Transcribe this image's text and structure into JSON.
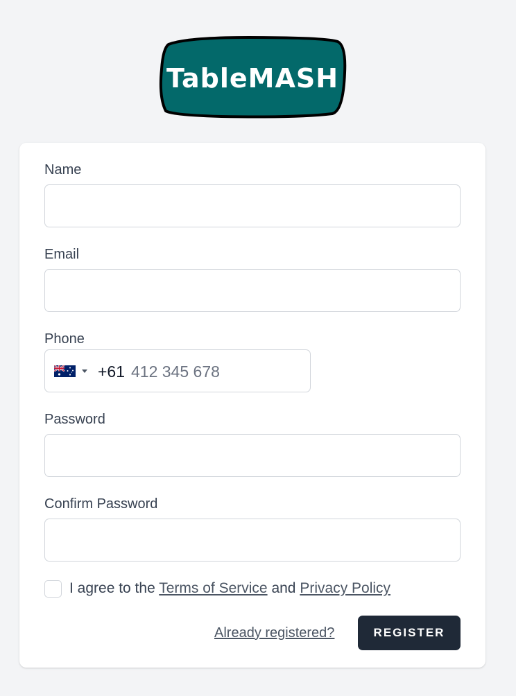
{
  "brand": {
    "logo_text": "TableMASH",
    "logo_fill": "#03696a",
    "logo_stroke": "#000000"
  },
  "form": {
    "name": {
      "label": "Name",
      "value": ""
    },
    "email": {
      "label": "Email",
      "value": ""
    },
    "phone": {
      "label": "Phone",
      "country_flag": "australia-flag",
      "dial_code": "+61",
      "value": "",
      "placeholder": "412 345 678"
    },
    "password": {
      "label": "Password",
      "value": ""
    },
    "confirm_password": {
      "label": "Confirm Password",
      "value": ""
    },
    "agree": {
      "checked": false,
      "prefix": "I agree to the",
      "terms_link": "Terms of Service",
      "conjunction": "and",
      "privacy_link": "Privacy Policy"
    },
    "already_registered_link": "Already registered?",
    "register_button": "REGISTER"
  },
  "colors": {
    "page_bg": "#f3f4f6",
    "button_bg": "#1f2937",
    "border": "#d1d5db"
  }
}
